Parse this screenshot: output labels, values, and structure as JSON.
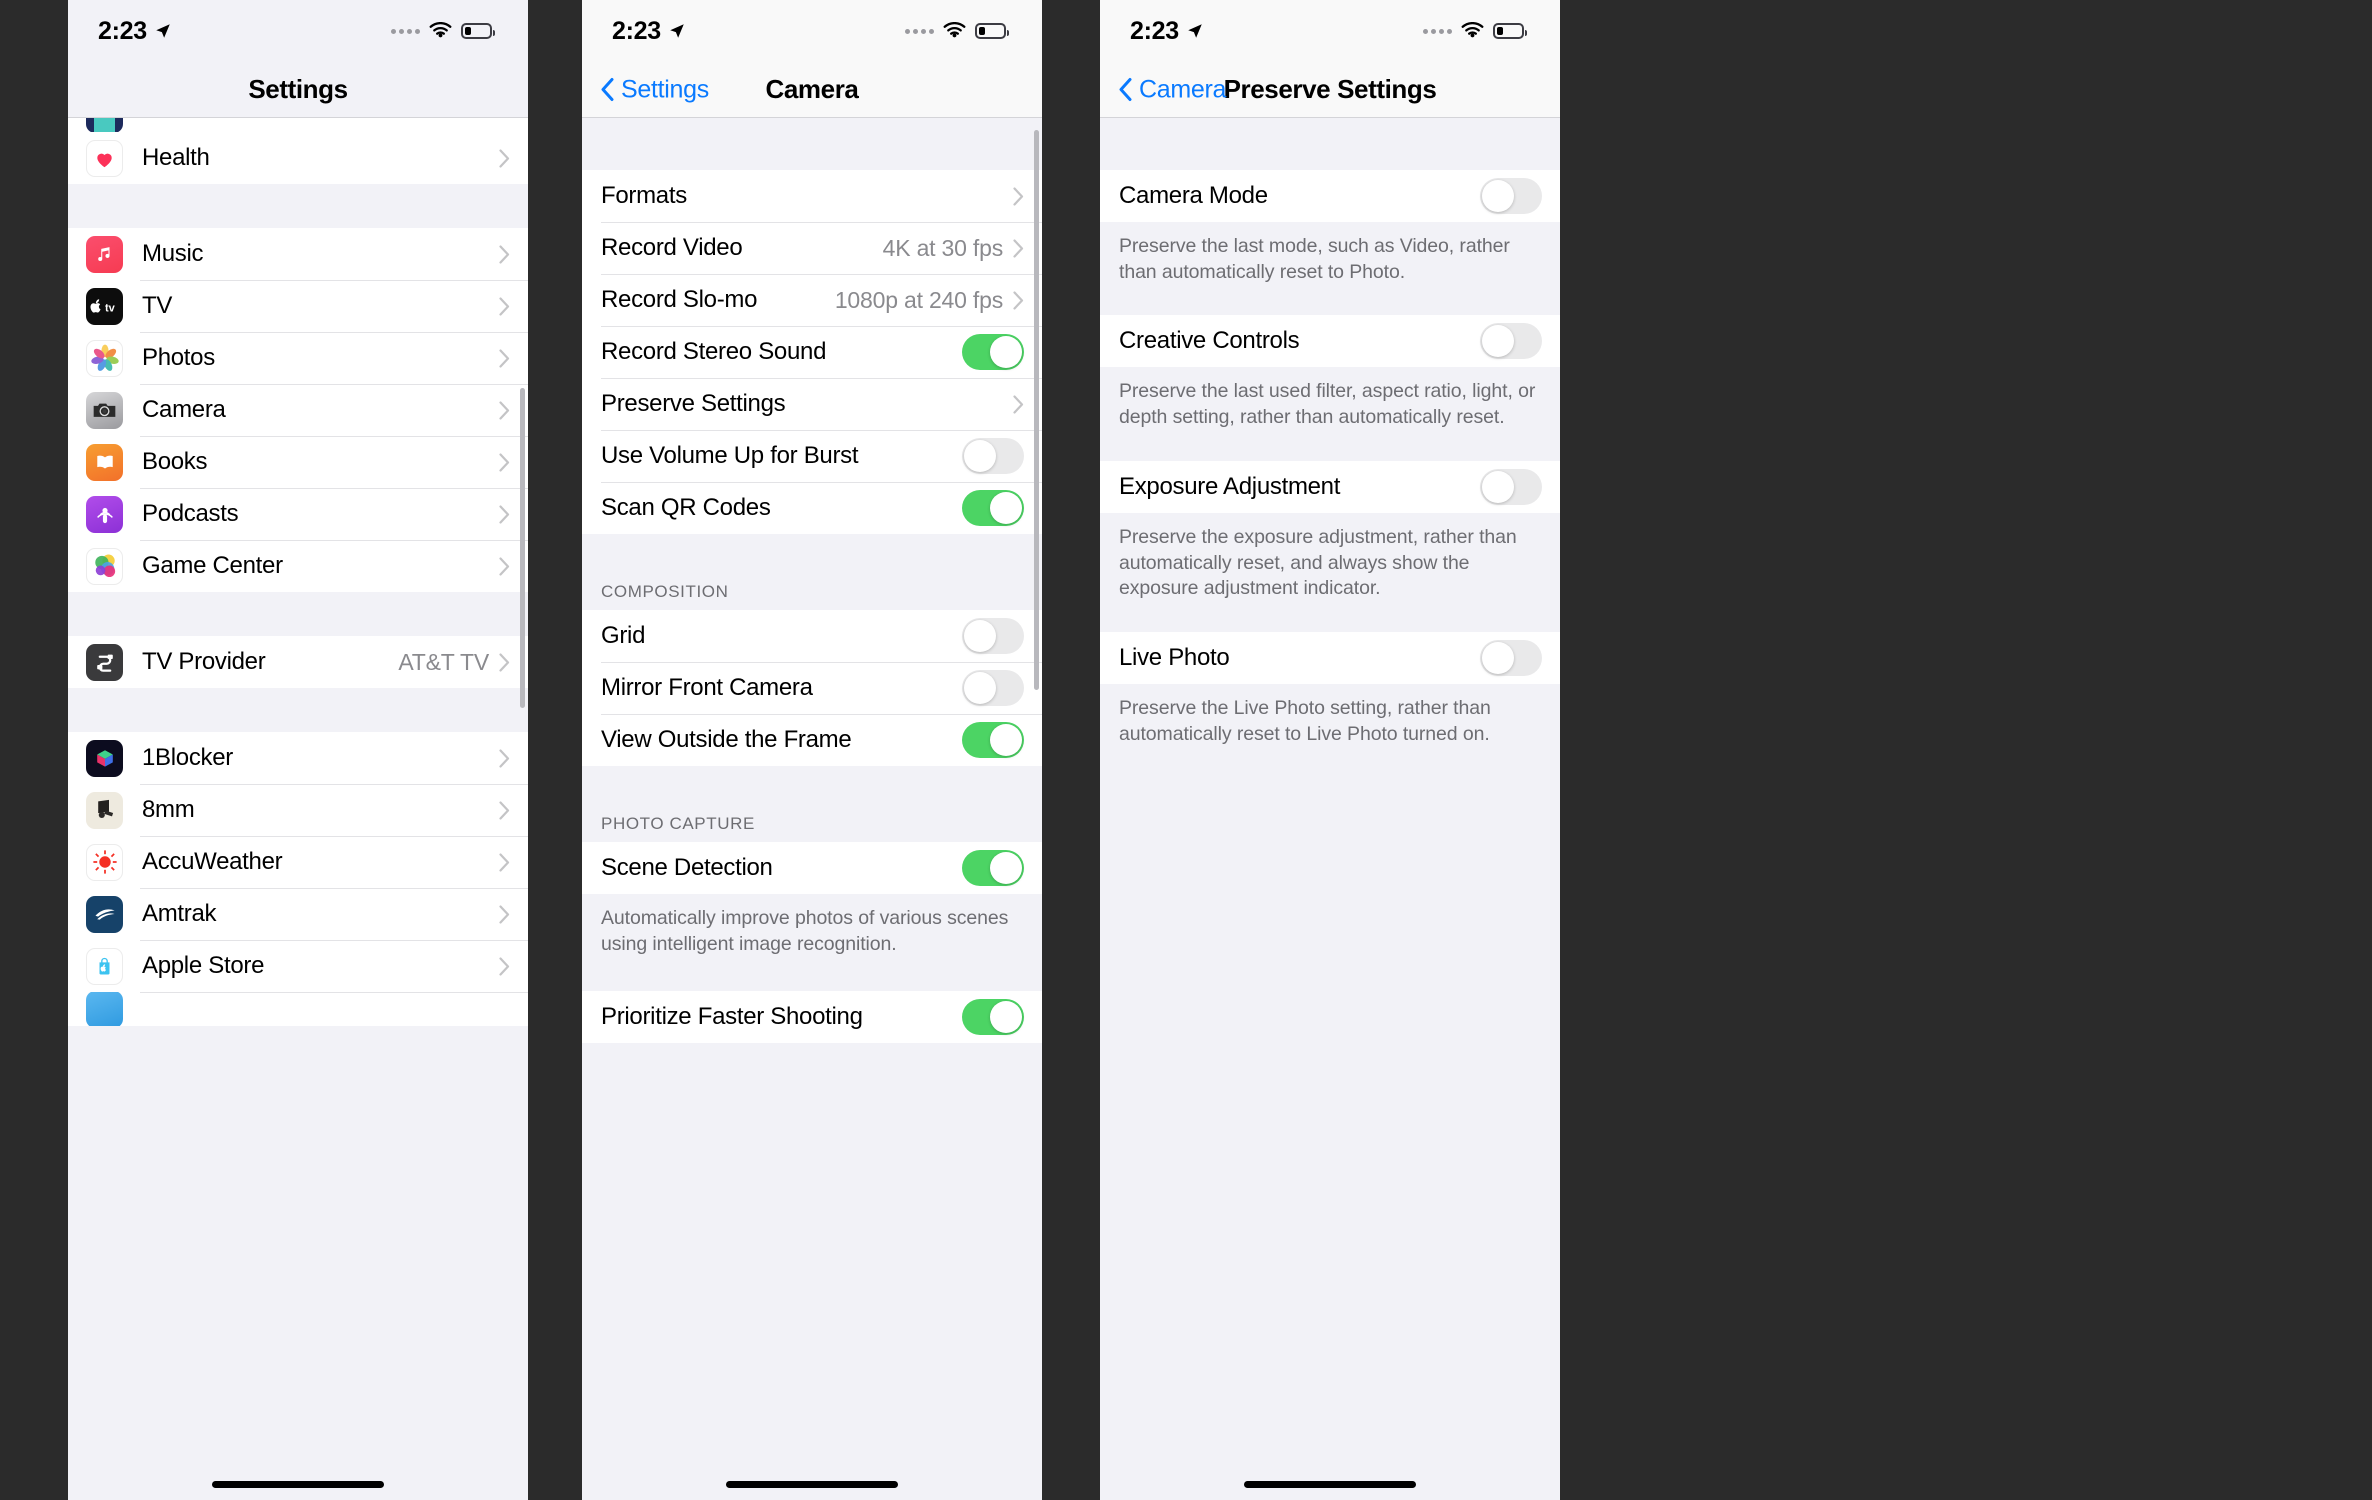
{
  "status": {
    "time": "2:23",
    "location_icon": "location-arrow-icon",
    "wifi_icon": "wifi-icon",
    "battery_icon": "battery-low-icon"
  },
  "phone1": {
    "nav": {
      "title": "Settings"
    },
    "groups": [
      {
        "rows": [
          {
            "label": "Health",
            "icon": "health-icon",
            "accessory": "chevron"
          }
        ]
      },
      {
        "rows": [
          {
            "label": "Music",
            "icon": "music-icon",
            "accessory": "chevron"
          },
          {
            "label": "TV",
            "icon": "apple-tv-icon",
            "accessory": "chevron"
          },
          {
            "label": "Photos",
            "icon": "photos-icon",
            "accessory": "chevron"
          },
          {
            "label": "Camera",
            "icon": "camera-icon",
            "accessory": "chevron"
          },
          {
            "label": "Books",
            "icon": "books-icon",
            "accessory": "chevron"
          },
          {
            "label": "Podcasts",
            "icon": "podcasts-icon",
            "accessory": "chevron"
          },
          {
            "label": "Game Center",
            "icon": "game-center-icon",
            "accessory": "chevron"
          }
        ]
      },
      {
        "rows": [
          {
            "label": "TV Provider",
            "icon": "tv-provider-icon",
            "value": "AT&T TV",
            "accessory": "chevron"
          }
        ]
      },
      {
        "rows": [
          {
            "label": "1Blocker",
            "icon": "1blocker-icon",
            "accessory": "chevron"
          },
          {
            "label": "8mm",
            "icon": "8mm-icon",
            "accessory": "chevron"
          },
          {
            "label": "AccuWeather",
            "icon": "accuweather-icon",
            "accessory": "chevron"
          },
          {
            "label": "Amtrak",
            "icon": "amtrak-icon",
            "accessory": "chevron"
          },
          {
            "label": "Apple Store",
            "icon": "apple-store-icon",
            "accessory": "chevron"
          }
        ]
      }
    ]
  },
  "phone2": {
    "nav": {
      "back_label": "Settings",
      "title": "Camera"
    },
    "rows_main": [
      {
        "label": "Formats",
        "type": "link"
      },
      {
        "label": "Record Video",
        "type": "link",
        "value": "4K at 30 fps"
      },
      {
        "label": "Record Slo-mo",
        "type": "link",
        "value": "1080p at 240 fps"
      },
      {
        "label": "Record Stereo Sound",
        "type": "toggle",
        "on": true
      },
      {
        "label": "Preserve Settings",
        "type": "link"
      },
      {
        "label": "Use Volume Up for Burst",
        "type": "toggle",
        "on": false
      },
      {
        "label": "Scan QR Codes",
        "type": "toggle",
        "on": true
      }
    ],
    "composition_header": "COMPOSITION",
    "rows_composition": [
      {
        "label": "Grid",
        "type": "toggle",
        "on": false
      },
      {
        "label": "Mirror Front Camera",
        "type": "toggle",
        "on": false
      },
      {
        "label": "View Outside the Frame",
        "type": "toggle",
        "on": true
      }
    ],
    "photo_capture_header": "PHOTO CAPTURE",
    "rows_photo_capture": [
      {
        "label": "Scene Detection",
        "type": "toggle",
        "on": true
      }
    ],
    "scene_detection_footnote": "Automatically improve photos of various scenes using intelligent image recognition.",
    "rows_photo_capture2": [
      {
        "label": "Prioritize Faster Shooting",
        "type": "toggle",
        "on": true
      }
    ]
  },
  "phone3": {
    "nav": {
      "back_label": "Camera",
      "title": "Preserve Settings"
    },
    "items": [
      {
        "label": "Camera Mode",
        "on": false,
        "footnote": "Preserve the last mode, such as Video, rather than automatically reset to Photo."
      },
      {
        "label": "Creative Controls",
        "on": false,
        "footnote": "Preserve the last used filter, aspect ratio, light, or depth setting, rather than automatically reset."
      },
      {
        "label": "Exposure Adjustment",
        "on": false,
        "footnote": "Preserve the exposure adjustment, rather than automatically reset, and always show the exposure adjustment indicator."
      },
      {
        "label": "Live Photo",
        "on": false,
        "footnote": "Preserve the Live Photo setting, rather than automatically reset to Live Photo turned on."
      }
    ]
  },
  "colors": {
    "accent_blue": "#0a7aff",
    "toggle_on_green": "#4cd464",
    "toggle_off_gray": "#e9e9ea",
    "group_background": "#f2f2f7",
    "secondary_text": "#8a8a8e"
  }
}
